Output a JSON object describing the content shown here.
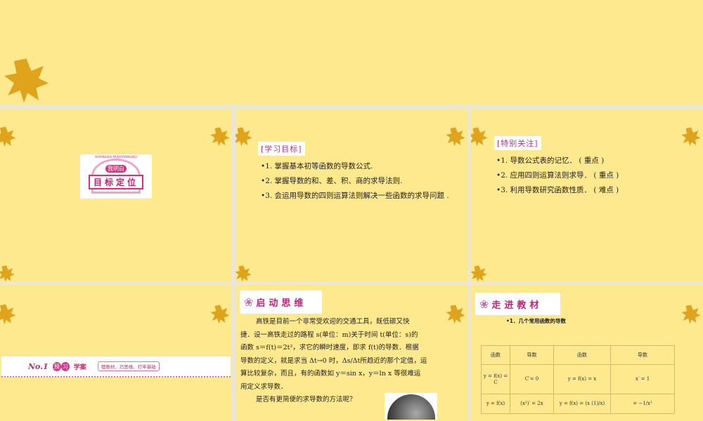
{
  "slide2": {
    "tag": "[学习目标]",
    "items": [
      "•1. 掌握基本初等函数的导数公式.",
      "•2. 掌握导数的和、差、积、商的求导法则.",
      "•3. 会运用导数的四则运算法则解决一些函数的求导问题 ."
    ]
  },
  "slide3": {
    "tag": "[特别关注]",
    "items": [
      "•1. 导数公式表的记忆． ( 重点 )",
      "•2. 应用四则运算法则求导． ( 重点 )",
      "•3. 利用导数研究函数性质． ( 难点 )"
    ]
  },
  "slide1": {
    "badge_top": "我明白",
    "badge_arc": "WOMINGBAI MUBIAODINGWEI",
    "badge_title": "目标定位"
  },
  "slide4": {
    "no": "No.1",
    "circle1": "预",
    "circle2": "习",
    "title": "学案",
    "subtitle": "理教材、巧思维、打牢基础"
  },
  "slide5": {
    "heading": "启动思维",
    "lines": [
      "高铁是目前一个非常受欢迎的交通工具，既低碳又快",
      "捷．设一高铁走过的路程 s(单位：m)关于时间 t(单位：s)的",
      "函数 s＝f(t)＝2t²，求它的瞬时速度，即求 f(t)的导数．根据",
      "导数的定义，就是求当 Δt→0 时，Δs/Δt所趋近的那个定值，运",
      "算比较复杂，而且，有的函数如 y＝sin x，y＝ln x 等很难运",
      "用定义求导数．",
      "是否有更简便的求导数的方法呢？"
    ]
  },
  "slide6": {
    "heading": "走进教材",
    "subtitle": "•1．几个常用函数的导数",
    "headers": [
      "函数",
      "导数",
      "函数",
      "导数"
    ],
    "rows": [
      [
        "y = f(x) = C",
        "C′= 0",
        "y = f(x) = x",
        "x′ = 1"
      ],
      [
        "y = f(x)",
        "(x²)′ = 2x",
        "y = f(x) = (x (1)/x)",
        "= −1/x²"
      ]
    ]
  }
}
